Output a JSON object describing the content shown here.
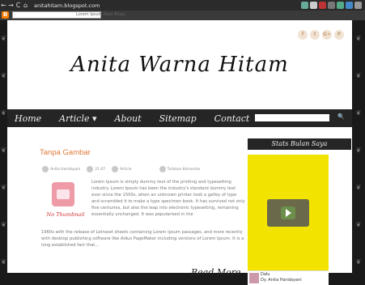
{
  "browser": {
    "url": "anitahitam.blogspot.com"
  },
  "bloggerbar": {
    "search_placeholder": "Lorem Ipsum",
    "next_blog": "Next Blog»"
  },
  "blog": {
    "title": "Anita Warna Hitam",
    "social": [
      "f",
      "t",
      "G+",
      "P"
    ]
  },
  "nav": {
    "items": [
      "Home",
      "Article ▾",
      "About",
      "Sitemap",
      "Contact"
    ],
    "search_btn": "🔍"
  },
  "post": {
    "title": "Tanpa Gambar",
    "meta_author": "Anita Handayani",
    "meta_date": "21.07",
    "meta_label": "Article",
    "meta_comments": "Tuliskan Komentar",
    "thumb_label": "No Thumbnail",
    "body_part1": "Lorem Ipsum is simply dummy text of the printing and typesetting industry. Lorem Ipsum has been the industry's standard dummy text ever since the 1500s, when an unknown printer took a galley of type and scrambled it to make a type specimen book. It has survived not only five centuries, but also the leap into electronic typesetting, remaining essentially unchanged. It was popularised in the",
    "body_part2": "1960s with the release of Letraset sheets containing Lorem Ipsum passages, and more recently with desktop publishing software like Aldus PageMaker including versions of Lorem Ipsum. It is a long established fact that...",
    "read_more": "Read More"
  },
  "sidebar": {
    "widget_title": "Stats Bulan Saya",
    "video_title": "Dalu",
    "video_sub": "Dy. Anita Handayani"
  }
}
